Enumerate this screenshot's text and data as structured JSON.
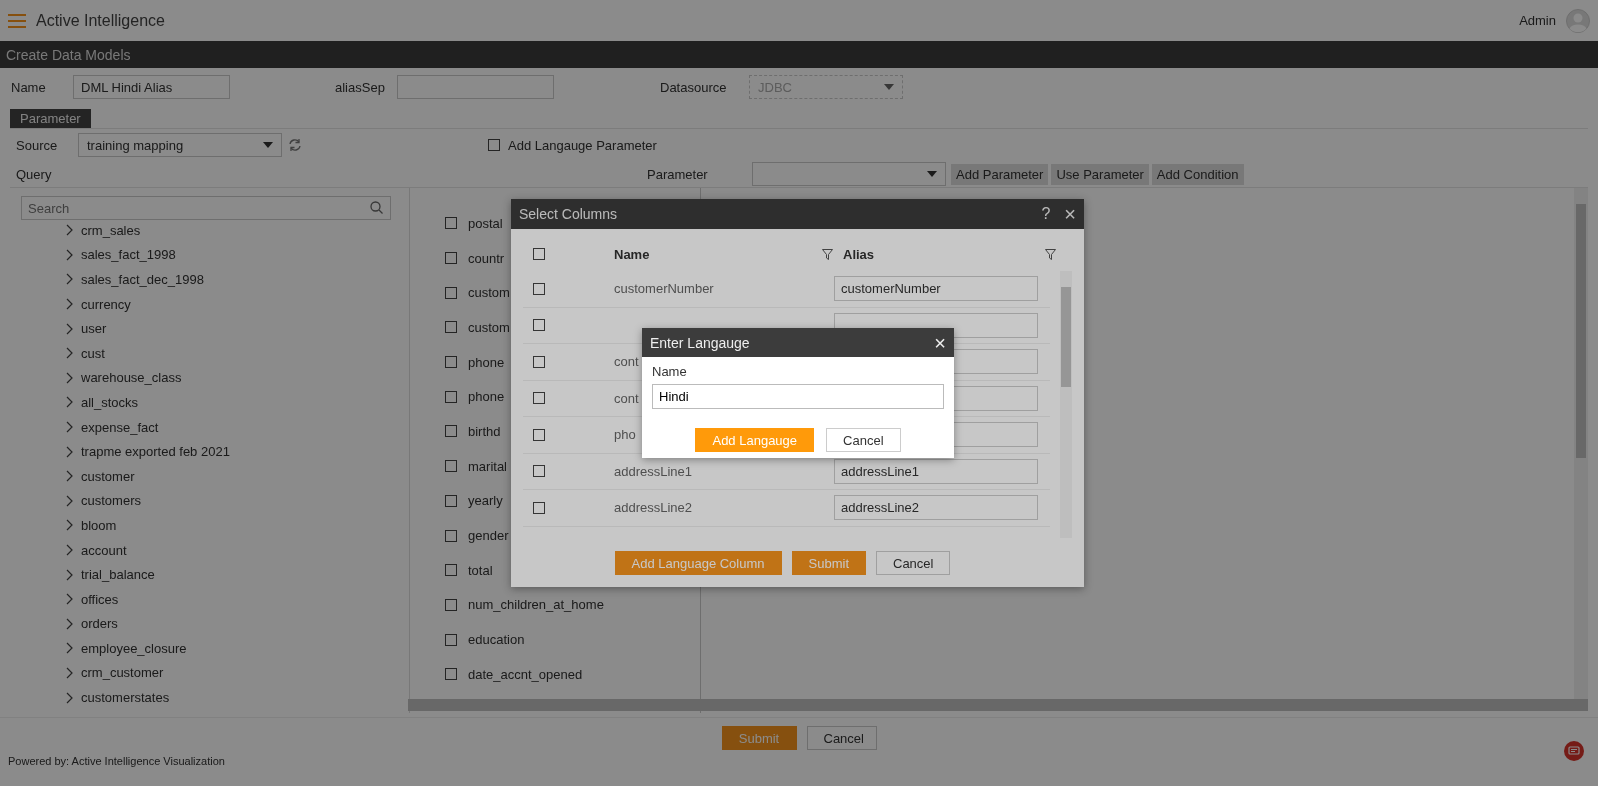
{
  "header": {
    "title": "Active Intelligence",
    "user": "Admin"
  },
  "page_title": "Create Data Models",
  "form": {
    "name_label": "Name",
    "name_value": "DML Hindi Alias",
    "alias_label": "aliasSep",
    "datasource_label": "Datasource",
    "datasource_value": "JDBC",
    "datasource_disabled": true
  },
  "tabs": [
    {
      "label": "Parameter",
      "selected": true
    }
  ],
  "source": {
    "label": "Source",
    "value": "training mapping"
  },
  "add_language_parameter": {
    "label": "Add Langauge Parameter",
    "checked": false
  },
  "query_label": "Query",
  "parameter": {
    "label": "Parameter",
    "buttons": [
      "Add Parameter",
      "Use Parameter",
      "Add Condition"
    ]
  },
  "search": {
    "placeholder": "Search"
  },
  "tree": [
    {
      "label": "crm_sales",
      "expanded": false
    },
    {
      "label": "sales_fact_1998",
      "expanded": false
    },
    {
      "label": "sales_fact_dec_1998",
      "expanded": false
    },
    {
      "label": "currency",
      "expanded": false
    },
    {
      "label": "user",
      "expanded": false
    },
    {
      "label": "cust",
      "expanded": false
    },
    {
      "label": "warehouse_class",
      "expanded": false
    },
    {
      "label": "all_stocks",
      "expanded": false
    },
    {
      "label": "expense_fact",
      "expanded": false
    },
    {
      "label": "trapme exported feb 2021",
      "expanded": false
    },
    {
      "label": "customer",
      "expanded": false
    },
    {
      "label": "customers",
      "expanded": false
    },
    {
      "label": "bloom",
      "expanded": false
    },
    {
      "label": "account",
      "expanded": false
    },
    {
      "label": "trial_balance",
      "expanded": false
    },
    {
      "label": "offices",
      "expanded": false
    },
    {
      "label": "orders",
      "expanded": false
    },
    {
      "label": "employee_closure",
      "expanded": false
    },
    {
      "label": "crm_customer",
      "expanded": false
    },
    {
      "label": "customerstates",
      "expanded": false
    }
  ],
  "columns": [
    {
      "label": "postal",
      "checked": false
    },
    {
      "label": "countr",
      "checked": false
    },
    {
      "label": "custom",
      "checked": false
    },
    {
      "label": "custom",
      "checked": false
    },
    {
      "label": "phone",
      "checked": false
    },
    {
      "label": "phone",
      "checked": false
    },
    {
      "label": "birthd",
      "checked": false
    },
    {
      "label": "marital",
      "checked": false
    },
    {
      "label": "yearly",
      "checked": false
    },
    {
      "label": "gender",
      "checked": false
    },
    {
      "label": "total",
      "checked": false
    },
    {
      "label": "num_children_at_home",
      "checked": false
    },
    {
      "label": "education",
      "checked": false
    },
    {
      "label": "date_accnt_opened",
      "checked": false
    }
  ],
  "footer_buttons": [
    {
      "label": "Submit",
      "kind": "primary"
    },
    {
      "label": "Cancel",
      "kind": "secondary"
    }
  ],
  "powered_by": "Powered by: Active Intelligence Visualization",
  "select_columns": {
    "title": "Select Columns",
    "help": "?",
    "close": "×",
    "header": {
      "name": "Name",
      "alias": "Alias",
      "checked": false
    },
    "rows": [
      {
        "name": "customerNumber",
        "alias": "customerNumber",
        "checked": false
      },
      {
        "checked": false
      },
      {
        "name": "cont",
        "checked": false
      },
      {
        "name": "cont",
        "checked": false
      },
      {
        "name": "pho",
        "checked": false
      },
      {
        "name": "addressLine1",
        "alias": "addressLine1",
        "checked": false
      },
      {
        "name": "addressLine2",
        "alias": "addressLine2",
        "checked": false
      }
    ],
    "buttons": [
      {
        "label": "Add Language Column",
        "kind": "primary"
      },
      {
        "label": "Submit",
        "kind": "primary"
      },
      {
        "label": "Cancel",
        "kind": "secondary"
      }
    ]
  },
  "enter_language": {
    "title": "Enter Langauge",
    "close": "×",
    "field_label": "Name",
    "value": "Hindi",
    "buttons": [
      {
        "label": "Add Langauge",
        "kind": "primary"
      },
      {
        "label": "Cancel",
        "kind": "secondary"
      }
    ]
  }
}
